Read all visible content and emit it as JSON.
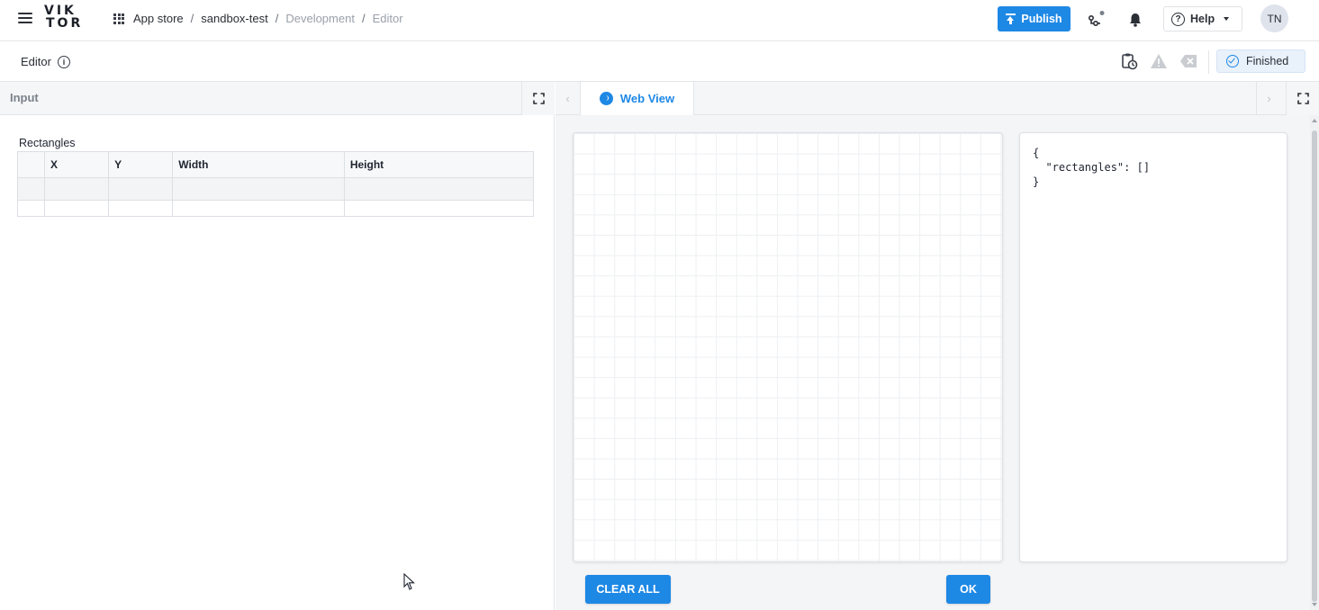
{
  "header": {
    "logo_line1": "VIK",
    "logo_line2": "TOR",
    "breadcrumbs": [
      "App store",
      "sandbox-test",
      "Development",
      "Editor"
    ],
    "publish_label": "Publish",
    "help_label": "Help",
    "avatar_initials": "TN"
  },
  "subbar": {
    "title": "Editor",
    "status": "Finished"
  },
  "input_panel": {
    "header": "Input",
    "table_label": "Rectangles",
    "columns": [
      "X",
      "Y",
      "Width",
      "Height"
    ]
  },
  "view_panel": {
    "tab_label": "Web View",
    "json_text": "{\n  \"rectangles\": []\n}",
    "clear_label": "CLEAR ALL",
    "ok_label": "OK"
  },
  "colors": {
    "accent": "#1e88e5"
  },
  "icons": [
    "menu-icon",
    "apps-grid-icon",
    "publish-arrow-icon",
    "deploy-icon",
    "bell-icon",
    "help-icon",
    "info-icon",
    "clipboard-clock-icon",
    "warning-icon",
    "delete-icon",
    "check-circle-icon",
    "expand-icon",
    "webview-icon",
    "chevron-left-icon",
    "chevron-right-icon"
  ]
}
